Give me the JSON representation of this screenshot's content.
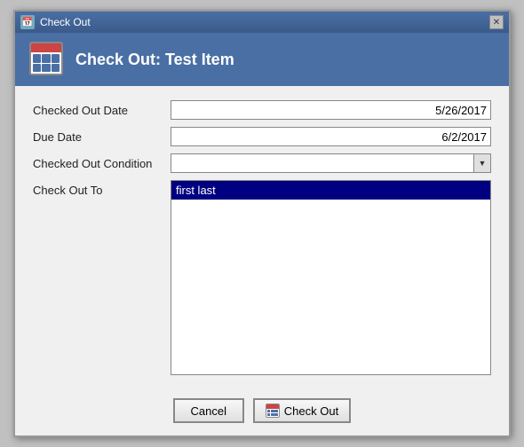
{
  "window": {
    "title": "Check Out",
    "close_label": "✕"
  },
  "dialog": {
    "header_title": "Check Out: Test Item",
    "icon_alt": "calendar-icon"
  },
  "form": {
    "checked_out_date_label": "Checked Out Date",
    "checked_out_date_value": "5/26/2017",
    "due_date_label": "Due Date",
    "due_date_value": "6/2/2017",
    "checked_out_condition_label": "Checked Out Condition",
    "checked_out_condition_value": "",
    "check_out_to_label": "Check Out To",
    "check_out_to_selected": "first last"
  },
  "buttons": {
    "cancel_label": "Cancel",
    "checkout_label": "Check Out"
  }
}
